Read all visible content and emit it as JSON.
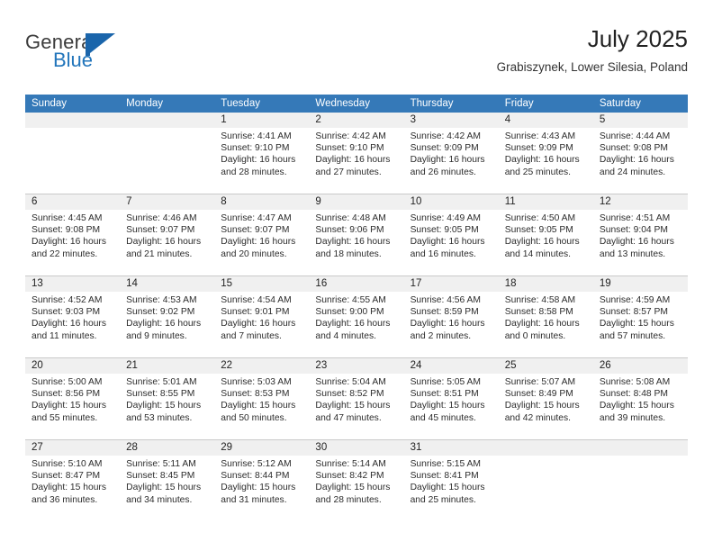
{
  "brand": {
    "name_part1": "General",
    "name_part2": "Blue"
  },
  "header": {
    "title": "July 2025",
    "location": "Grabiszynek, Lower Silesia, Poland"
  },
  "colors": {
    "header_blue": "#3579b8",
    "brand_blue": "#2275bb",
    "daynum_band": "#f0f0f0",
    "grid_line": "#c9c9c9"
  },
  "weekdays": [
    "Sunday",
    "Monday",
    "Tuesday",
    "Wednesday",
    "Thursday",
    "Friday",
    "Saturday"
  ],
  "weeks": [
    [
      {
        "day": "",
        "empty": true
      },
      {
        "day": "",
        "empty": true
      },
      {
        "day": "1",
        "sunrise": "Sunrise: 4:41 AM",
        "sunset": "Sunset: 9:10 PM",
        "daylight1": "Daylight: 16 hours",
        "daylight2": "and 28 minutes."
      },
      {
        "day": "2",
        "sunrise": "Sunrise: 4:42 AM",
        "sunset": "Sunset: 9:10 PM",
        "daylight1": "Daylight: 16 hours",
        "daylight2": "and 27 minutes."
      },
      {
        "day": "3",
        "sunrise": "Sunrise: 4:42 AM",
        "sunset": "Sunset: 9:09 PM",
        "daylight1": "Daylight: 16 hours",
        "daylight2": "and 26 minutes."
      },
      {
        "day": "4",
        "sunrise": "Sunrise: 4:43 AM",
        "sunset": "Sunset: 9:09 PM",
        "daylight1": "Daylight: 16 hours",
        "daylight2": "and 25 minutes."
      },
      {
        "day": "5",
        "sunrise": "Sunrise: 4:44 AM",
        "sunset": "Sunset: 9:08 PM",
        "daylight1": "Daylight: 16 hours",
        "daylight2": "and 24 minutes."
      }
    ],
    [
      {
        "day": "6",
        "sunrise": "Sunrise: 4:45 AM",
        "sunset": "Sunset: 9:08 PM",
        "daylight1": "Daylight: 16 hours",
        "daylight2": "and 22 minutes."
      },
      {
        "day": "7",
        "sunrise": "Sunrise: 4:46 AM",
        "sunset": "Sunset: 9:07 PM",
        "daylight1": "Daylight: 16 hours",
        "daylight2": "and 21 minutes."
      },
      {
        "day": "8",
        "sunrise": "Sunrise: 4:47 AM",
        "sunset": "Sunset: 9:07 PM",
        "daylight1": "Daylight: 16 hours",
        "daylight2": "and 20 minutes."
      },
      {
        "day": "9",
        "sunrise": "Sunrise: 4:48 AM",
        "sunset": "Sunset: 9:06 PM",
        "daylight1": "Daylight: 16 hours",
        "daylight2": "and 18 minutes."
      },
      {
        "day": "10",
        "sunrise": "Sunrise: 4:49 AM",
        "sunset": "Sunset: 9:05 PM",
        "daylight1": "Daylight: 16 hours",
        "daylight2": "and 16 minutes."
      },
      {
        "day": "11",
        "sunrise": "Sunrise: 4:50 AM",
        "sunset": "Sunset: 9:05 PM",
        "daylight1": "Daylight: 16 hours",
        "daylight2": "and 14 minutes."
      },
      {
        "day": "12",
        "sunrise": "Sunrise: 4:51 AM",
        "sunset": "Sunset: 9:04 PM",
        "daylight1": "Daylight: 16 hours",
        "daylight2": "and 13 minutes."
      }
    ],
    [
      {
        "day": "13",
        "sunrise": "Sunrise: 4:52 AM",
        "sunset": "Sunset: 9:03 PM",
        "daylight1": "Daylight: 16 hours",
        "daylight2": "and 11 minutes."
      },
      {
        "day": "14",
        "sunrise": "Sunrise: 4:53 AM",
        "sunset": "Sunset: 9:02 PM",
        "daylight1": "Daylight: 16 hours",
        "daylight2": "and 9 minutes."
      },
      {
        "day": "15",
        "sunrise": "Sunrise: 4:54 AM",
        "sunset": "Sunset: 9:01 PM",
        "daylight1": "Daylight: 16 hours",
        "daylight2": "and 7 minutes."
      },
      {
        "day": "16",
        "sunrise": "Sunrise: 4:55 AM",
        "sunset": "Sunset: 9:00 PM",
        "daylight1": "Daylight: 16 hours",
        "daylight2": "and 4 minutes."
      },
      {
        "day": "17",
        "sunrise": "Sunrise: 4:56 AM",
        "sunset": "Sunset: 8:59 PM",
        "daylight1": "Daylight: 16 hours",
        "daylight2": "and 2 minutes."
      },
      {
        "day": "18",
        "sunrise": "Sunrise: 4:58 AM",
        "sunset": "Sunset: 8:58 PM",
        "daylight1": "Daylight: 16 hours",
        "daylight2": "and 0 minutes."
      },
      {
        "day": "19",
        "sunrise": "Sunrise: 4:59 AM",
        "sunset": "Sunset: 8:57 PM",
        "daylight1": "Daylight: 15 hours",
        "daylight2": "and 57 minutes."
      }
    ],
    [
      {
        "day": "20",
        "sunrise": "Sunrise: 5:00 AM",
        "sunset": "Sunset: 8:56 PM",
        "daylight1": "Daylight: 15 hours",
        "daylight2": "and 55 minutes."
      },
      {
        "day": "21",
        "sunrise": "Sunrise: 5:01 AM",
        "sunset": "Sunset: 8:55 PM",
        "daylight1": "Daylight: 15 hours",
        "daylight2": "and 53 minutes."
      },
      {
        "day": "22",
        "sunrise": "Sunrise: 5:03 AM",
        "sunset": "Sunset: 8:53 PM",
        "daylight1": "Daylight: 15 hours",
        "daylight2": "and 50 minutes."
      },
      {
        "day": "23",
        "sunrise": "Sunrise: 5:04 AM",
        "sunset": "Sunset: 8:52 PM",
        "daylight1": "Daylight: 15 hours",
        "daylight2": "and 47 minutes."
      },
      {
        "day": "24",
        "sunrise": "Sunrise: 5:05 AM",
        "sunset": "Sunset: 8:51 PM",
        "daylight1": "Daylight: 15 hours",
        "daylight2": "and 45 minutes."
      },
      {
        "day": "25",
        "sunrise": "Sunrise: 5:07 AM",
        "sunset": "Sunset: 8:49 PM",
        "daylight1": "Daylight: 15 hours",
        "daylight2": "and 42 minutes."
      },
      {
        "day": "26",
        "sunrise": "Sunrise: 5:08 AM",
        "sunset": "Sunset: 8:48 PM",
        "daylight1": "Daylight: 15 hours",
        "daylight2": "and 39 minutes."
      }
    ],
    [
      {
        "day": "27",
        "sunrise": "Sunrise: 5:10 AM",
        "sunset": "Sunset: 8:47 PM",
        "daylight1": "Daylight: 15 hours",
        "daylight2": "and 36 minutes."
      },
      {
        "day": "28",
        "sunrise": "Sunrise: 5:11 AM",
        "sunset": "Sunset: 8:45 PM",
        "daylight1": "Daylight: 15 hours",
        "daylight2": "and 34 minutes."
      },
      {
        "day": "29",
        "sunrise": "Sunrise: 5:12 AM",
        "sunset": "Sunset: 8:44 PM",
        "daylight1": "Daylight: 15 hours",
        "daylight2": "and 31 minutes."
      },
      {
        "day": "30",
        "sunrise": "Sunrise: 5:14 AM",
        "sunset": "Sunset: 8:42 PM",
        "daylight1": "Daylight: 15 hours",
        "daylight2": "and 28 minutes."
      },
      {
        "day": "31",
        "sunrise": "Sunrise: 5:15 AM",
        "sunset": "Sunset: 8:41 PM",
        "daylight1": "Daylight: 15 hours",
        "daylight2": "and 25 minutes."
      },
      {
        "day": "",
        "empty": true
      },
      {
        "day": "",
        "empty": true
      }
    ]
  ]
}
